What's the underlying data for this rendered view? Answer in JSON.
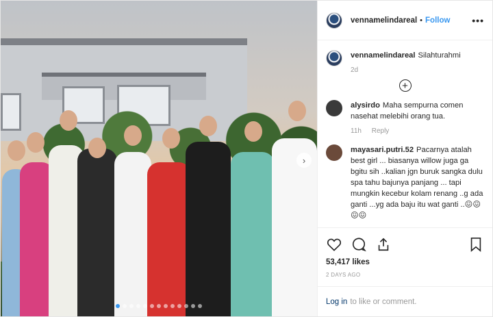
{
  "post": {
    "username": "vennamelindareal",
    "separator": "•",
    "follow_label": "Follow",
    "more_label": "•••",
    "caption_username": "vennamelindareal",
    "caption_text": "Silahturahmi",
    "caption_age": "2d",
    "load_more_label": "+"
  },
  "comments": [
    {
      "username": "alysirdo",
      "text": "Maha sempurna comen nasehat melebihi orang tua.",
      "age": "11h",
      "reply_label": "Reply",
      "avatar_color": "#3a3a3a"
    },
    {
      "username": "mayasari.putri.52",
      "text": "Pacarnya atalah best girl ... biasanya willow juga ga bgitu sih ..kalian jgn buruk sangka dulu spa tahu bajunya panjang ... tapi mungkin kecebur kolam renang ..g ada ganti ...yg ada baju itu wat ganti ..😖😖😖😖",
      "avatar_color": "#6b4a3a"
    }
  ],
  "actions": {
    "like_icon": "heart-icon",
    "comment_icon": "comment-icon",
    "share_icon": "share-icon",
    "save_icon": "bookmark-icon",
    "likes": "53,417 likes",
    "timestamp": "2 DAYS AGO"
  },
  "footer": {
    "login_label": "Log in",
    "login_suffix": "to like or comment."
  },
  "carousel": {
    "next_icon": "chevron-right-icon",
    "dot_count": 13,
    "active_index": 0
  },
  "colors": {
    "link_blue": "#3897f0",
    "login_blue": "#003569",
    "muted": "#999999",
    "text": "#262626"
  }
}
